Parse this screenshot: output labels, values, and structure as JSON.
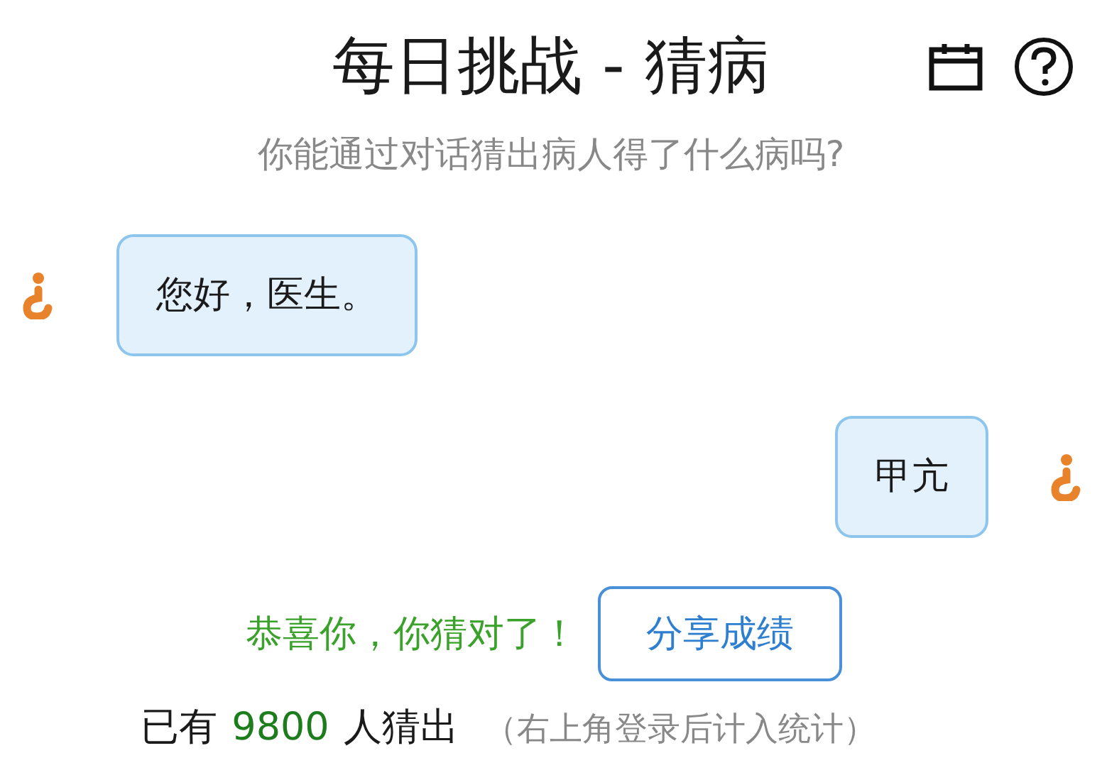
{
  "header": {
    "title": "每日挑战 - 猜病",
    "subtitle": "你能通过对话猜出病人得了什么病吗?"
  },
  "messages": [
    {
      "kind": "received",
      "text": "您好，医生。"
    },
    {
      "kind": "sent",
      "text": "甲亢"
    }
  ],
  "result": {
    "message": "恭喜你，你猜对了！",
    "share_button": "分享成绩"
  },
  "stats": {
    "prefix": "已有",
    "count": "9800",
    "suffix": "人猜出",
    "note": "（右上角登录后计入统计）"
  }
}
